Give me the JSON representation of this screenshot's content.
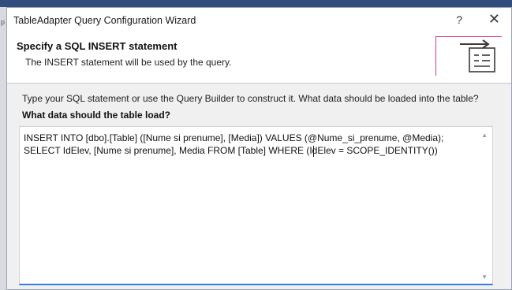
{
  "window": {
    "title": "TableAdapter Query Configuration Wizard",
    "help_label": "?",
    "close_label": "✕"
  },
  "header": {
    "title": "Specify a SQL INSERT statement",
    "subtitle": "The INSERT statement will be used by the query.",
    "icon": "wizard-sql-icon"
  },
  "body": {
    "instruction": "Type your SQL statement or use the Query Builder to construct it. What data should be loaded into the table?",
    "question": "What data should the table load?"
  },
  "sql_editor": {
    "line1": "INSERT INTO [dbo].[Table] ([Nume si prenume], [Media]) VALUES (@Nume_si_prenume, @Media);",
    "line2": "SELECT IdElev, [Nume si prenume], Media FROM [Table] WHERE (IdElev = SCOPE_IDENTITY())",
    "scroll_up": "▲",
    "scroll_down": "▼"
  },
  "colors": {
    "accent_blue": "#3a7bd5",
    "icon_magenta": "#d33a8e",
    "titlebar_strip": "#2f4e7e"
  }
}
